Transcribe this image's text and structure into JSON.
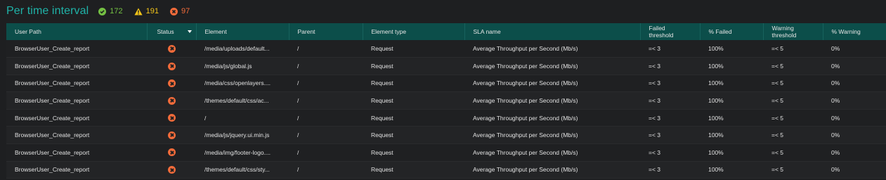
{
  "header": {
    "title": "Per time interval",
    "stats": {
      "ok": "172",
      "warning": "191",
      "error": "97"
    }
  },
  "colors": {
    "title": "#1fb3a8",
    "ok": "#74c043",
    "warning": "#f3c519",
    "error": "#f26b3a",
    "header_bg": "#0c4e4a"
  },
  "table": {
    "columns": {
      "user_path": "User Path",
      "status": "Status",
      "element": "Element",
      "parent": "Parent",
      "element_type": "Element type",
      "sla_name": "SLA name",
      "failed_threshold_1": "Failed",
      "failed_threshold_2": "threshold",
      "pct_failed": "% Failed",
      "warning_threshold_1": "Warning",
      "warning_threshold_2": "threshold",
      "pct_warning": "% Warning"
    },
    "rows": [
      {
        "user_path": "BrowserUser_Create_report",
        "status": "error-icon",
        "element": "/media/uploads/default...",
        "parent": "/",
        "element_type": "Request",
        "sla_name": "Average Throughput per Second (Mb/s)",
        "failed_threshold": "=< 3",
        "pct_failed": "100%",
        "warning_threshold": "=< 5",
        "pct_warning": "0%"
      },
      {
        "user_path": "BrowserUser_Create_report",
        "status": "error-icon",
        "element": "/media/js/global.js",
        "parent": "/",
        "element_type": "Request",
        "sla_name": "Average Throughput per Second (Mb/s)",
        "failed_threshold": "=< 3",
        "pct_failed": "100%",
        "warning_threshold": "=< 5",
        "pct_warning": "0%"
      },
      {
        "user_path": "BrowserUser_Create_report",
        "status": "error-icon",
        "element": "/media/css/openlayers....",
        "parent": "/",
        "element_type": "Request",
        "sla_name": "Average Throughput per Second (Mb/s)",
        "failed_threshold": "=< 3",
        "pct_failed": "100%",
        "warning_threshold": "=< 5",
        "pct_warning": "0%"
      },
      {
        "user_path": "BrowserUser_Create_report",
        "status": "error-icon",
        "element": "/themes/default/css/ac...",
        "parent": "/",
        "element_type": "Request",
        "sla_name": "Average Throughput per Second (Mb/s)",
        "failed_threshold": "=< 3",
        "pct_failed": "100%",
        "warning_threshold": "=< 5",
        "pct_warning": "0%"
      },
      {
        "user_path": "BrowserUser_Create_report",
        "status": "error-icon",
        "element": "/",
        "parent": "/",
        "element_type": "Request",
        "sla_name": "Average Throughput per Second (Mb/s)",
        "failed_threshold": "=< 3",
        "pct_failed": "100%",
        "warning_threshold": "=< 5",
        "pct_warning": "0%"
      },
      {
        "user_path": "BrowserUser_Create_report",
        "status": "error-icon",
        "element": "/media/js/jquery.ui.min.js",
        "parent": "/",
        "element_type": "Request",
        "sla_name": "Average Throughput per Second (Mb/s)",
        "failed_threshold": "=< 3",
        "pct_failed": "100%",
        "warning_threshold": "=< 5",
        "pct_warning": "0%"
      },
      {
        "user_path": "BrowserUser_Create_report",
        "status": "error-icon",
        "element": "/media/img/footer-logo....",
        "parent": "/",
        "element_type": "Request",
        "sla_name": "Average Throughput per Second (Mb/s)",
        "failed_threshold": "=< 3",
        "pct_failed": "100%",
        "warning_threshold": "=< 5",
        "pct_warning": "0%"
      },
      {
        "user_path": "BrowserUser_Create_report",
        "status": "error-icon",
        "element": "/themes/default/css/sty...",
        "parent": "/",
        "element_type": "Request",
        "sla_name": "Average Throughput per Second (Mb/s)",
        "failed_threshold": "=< 3",
        "pct_failed": "100%",
        "warning_threshold": "=< 5",
        "pct_warning": "0%"
      }
    ]
  }
}
